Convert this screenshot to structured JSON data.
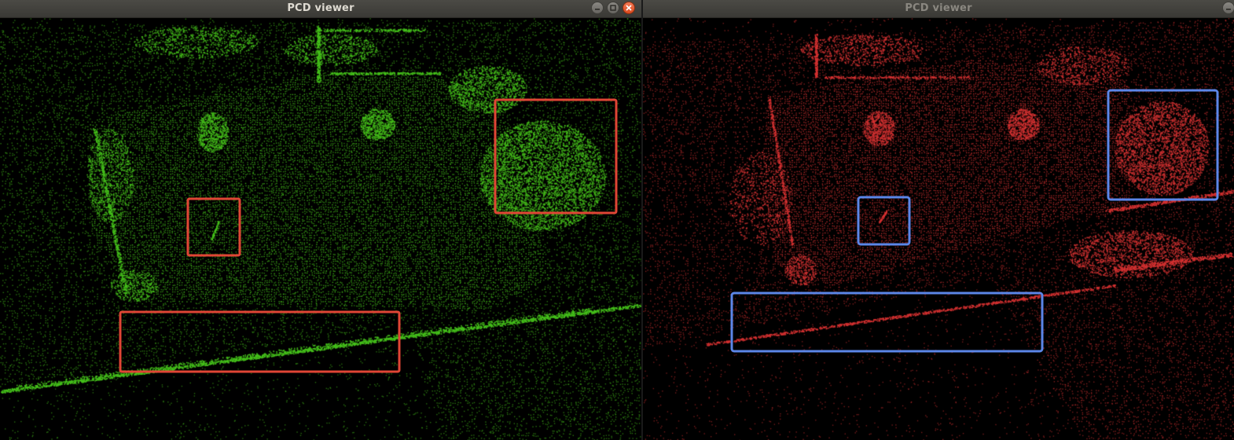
{
  "windows": [
    {
      "id": "left",
      "title": "PCD viewer",
      "point_color": "#46c21b",
      "annotation_color": "#e04535",
      "controls": [
        "minimize-icon",
        "maximize-icon",
        "close-icon"
      ]
    },
    {
      "id": "right",
      "title": "PCD viewer",
      "point_color": "#d63232",
      "annotation_color": "#5b86e8",
      "controls": [
        "minimize-icon"
      ]
    }
  ]
}
